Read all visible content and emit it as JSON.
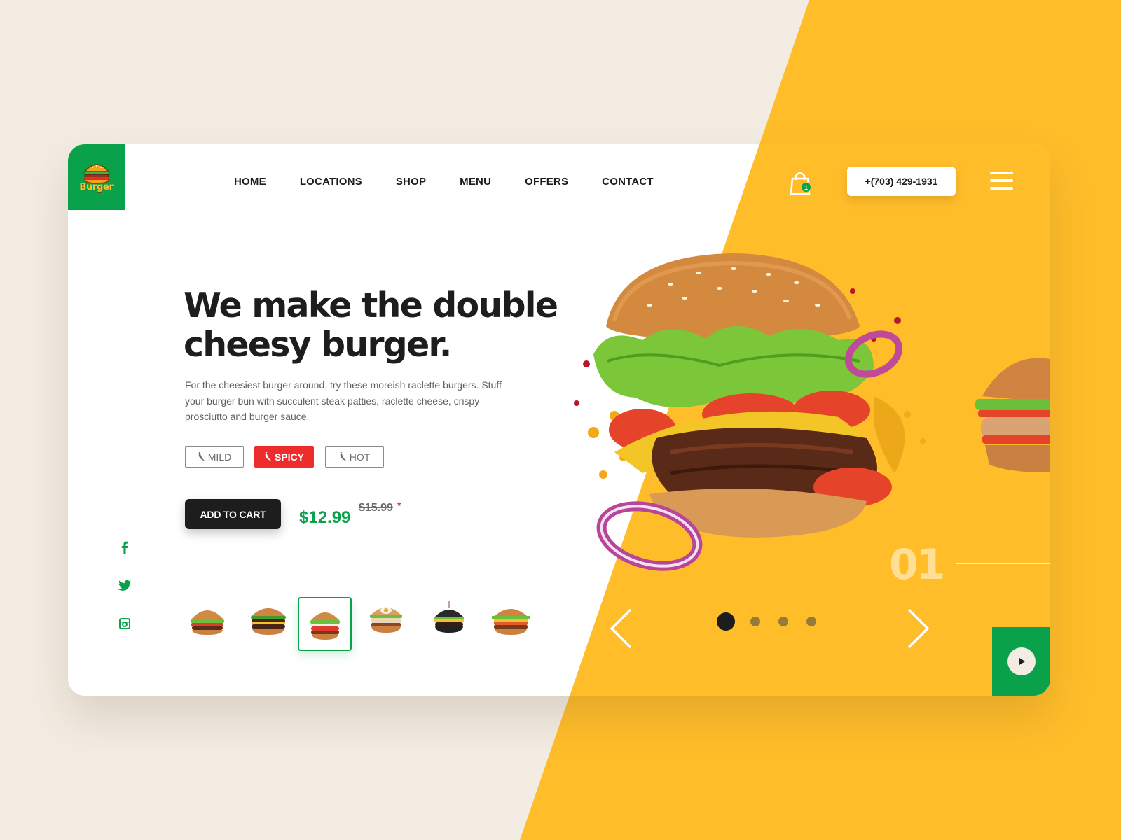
{
  "brand": {
    "logo_text": "Burger"
  },
  "nav": {
    "items": [
      "HOME",
      "LOCATIONS",
      "SHOP",
      "MENU",
      "OFFERS",
      "CONTACT"
    ]
  },
  "header": {
    "cart_count": "1",
    "phone": "+(703) 429-1931",
    "cart_icon": "shopping-bag-icon",
    "menu_icon": "hamburger-menu-icon"
  },
  "hero": {
    "headline_line1": "We make the double",
    "headline_line2": "cheesy burger.",
    "description": "For the cheesiest burger around, try these moreish raclette burgers. Stuff your burger bun with succulent steak patties, raclette cheese, crispy prosciutto and  burger sauce.",
    "spice_levels": [
      "MILD",
      "SPICY",
      "HOT"
    ],
    "selected_spice": "SPICY",
    "add_to_cart_label": "ADD TO CART",
    "price": "$12.99",
    "old_price": "$15.99",
    "old_price_marker": "*"
  },
  "slider": {
    "current_number": "01",
    "total_slides": 4,
    "active_slide": 1
  },
  "thumbnails": {
    "count": 6,
    "selected_index": 2
  },
  "social": [
    "facebook-icon",
    "twitter-icon",
    "instagram-icon"
  ],
  "colors": {
    "green": "#09a24a",
    "yellow": "#ffbd2a",
    "red": "#ee2c2c",
    "dark": "#1d1d1d",
    "background": "#f3ece2"
  }
}
